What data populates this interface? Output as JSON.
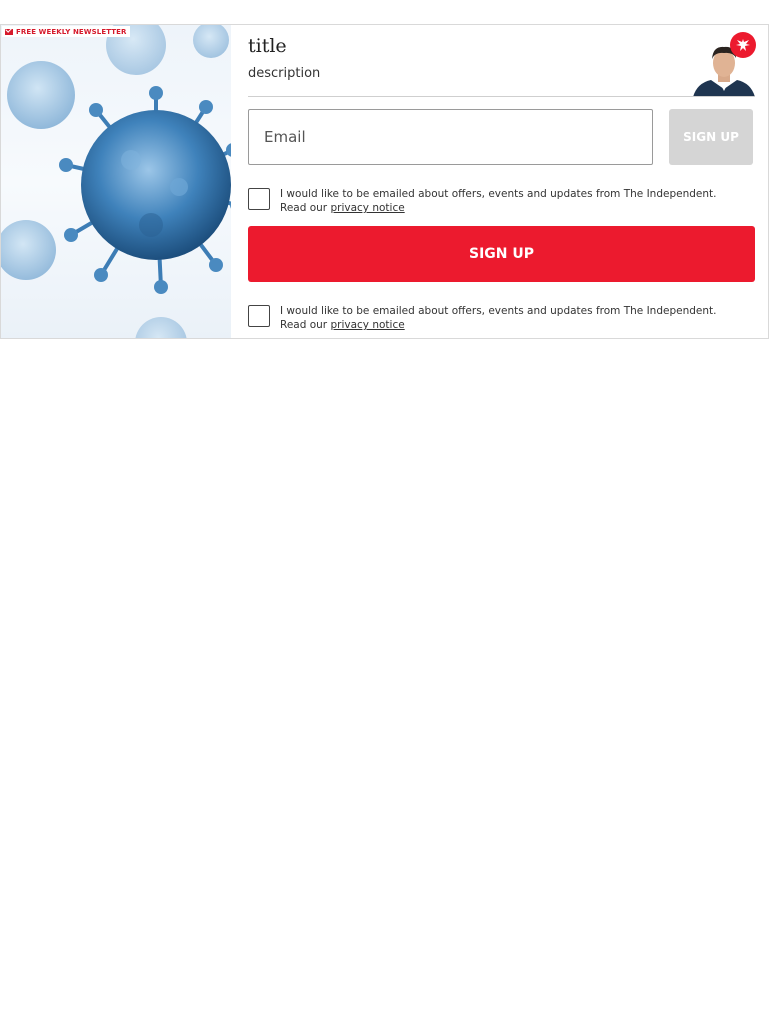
{
  "newsletter": {
    "badge_label": "FREE WEEKLY NEWSLETTER",
    "title": "title",
    "description": "description",
    "email_placeholder": "Email",
    "signup_small_label": "SIGN UP",
    "signup_button_label": "SIGN UP",
    "consent_1": {
      "text": "I would like to be emailed about offers, events and updates from The Independent. Read our ",
      "link": "privacy notice"
    },
    "consent_2": {
      "text": "I would like to be emailed about offers, events and updates from The Independent. Read our ",
      "link": "privacy notice"
    }
  },
  "colors": {
    "brand_red": "#ec1a2e",
    "disabled_button": "#d5d5d5",
    "virus_blue": "#2f6fa6"
  },
  "icons": [
    "envelope-icon",
    "independent-eagle-logo"
  ]
}
